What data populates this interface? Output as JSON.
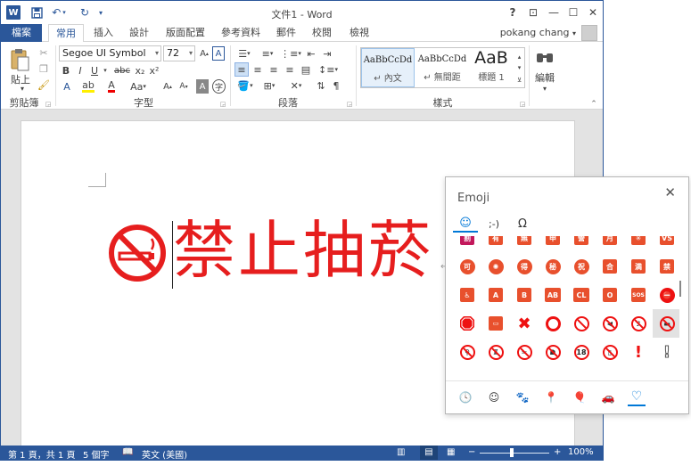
{
  "titlebar": {
    "app_letter": "W",
    "title": "文件1 - Word",
    "help": "?",
    "ribbon_display": "⊡",
    "minimize": "—",
    "maximize": "☐",
    "close": "✕"
  },
  "tabs": {
    "file": "檔案",
    "items": [
      "常用",
      "插入",
      "設計",
      "版面配置",
      "參考資料",
      "郵件",
      "校閱",
      "檢視"
    ],
    "active_index": 0,
    "user": "pokang chang"
  },
  "ribbon": {
    "paste_label": "貼上",
    "font_name": "Segoe UI Symbol",
    "font_size": "72",
    "bold": "B",
    "italic": "I",
    "underline": "U",
    "strike": "abc",
    "subscript": "x₂",
    "superscript": "x²",
    "change_case": "Aa",
    "styles": [
      {
        "preview": "AaBbCcDd",
        "name": "↵ 內文"
      },
      {
        "preview": "AaBbCcDd",
        "name": "↵ 無間距"
      },
      {
        "preview": "AaB",
        "name": "標題 1"
      }
    ],
    "edit_label": "編輯",
    "groups": {
      "clipboard": "剪貼簿",
      "font": "字型",
      "paragraph": "段落",
      "styles": "樣式"
    }
  },
  "document": {
    "text": "禁止抽菸",
    "para_mark": "↵"
  },
  "statusbar": {
    "page": "第 1 頁，共 1 頁",
    "words": "5 個字",
    "language": "英文 (美國)",
    "zoom": "100%",
    "zoom_minus": "−",
    "zoom_plus": "+"
  },
  "emoji_panel": {
    "title": "Emoji",
    "close": "✕",
    "tabs": [
      "☺",
      ";-)",
      "Ω"
    ],
    "active_tab": 0,
    "row1": [
      "割",
      "有",
      "無",
      "申",
      "營",
      "月",
      "✳",
      "VS"
    ],
    "row2": [
      "可",
      "✺",
      "得",
      "秘",
      "祝",
      "合",
      "満",
      "禁"
    ],
    "row3": [
      "♿",
      "A",
      "B",
      "AB",
      "CL",
      "O",
      "SOS",
      "⛔"
    ],
    "row4": [
      "stop",
      "📵",
      "✖",
      "⭕",
      "🚫",
      "🔇",
      "🔕",
      "🚭"
    ],
    "row5": [
      "🚳",
      "🚯",
      "🚱",
      "🚷",
      "18",
      "📵",
      "!",
      "!"
    ],
    "categories": [
      "🕓",
      "☺",
      "🐾",
      "📍",
      "🎈",
      "🚗",
      "♡"
    ],
    "active_category": 6,
    "colors": {
      "accent": "#0078d7",
      "emoji_red": "#e8502d"
    }
  },
  "colors": {
    "word_blue": "#2b579a",
    "text_red": "#e61e1e"
  }
}
